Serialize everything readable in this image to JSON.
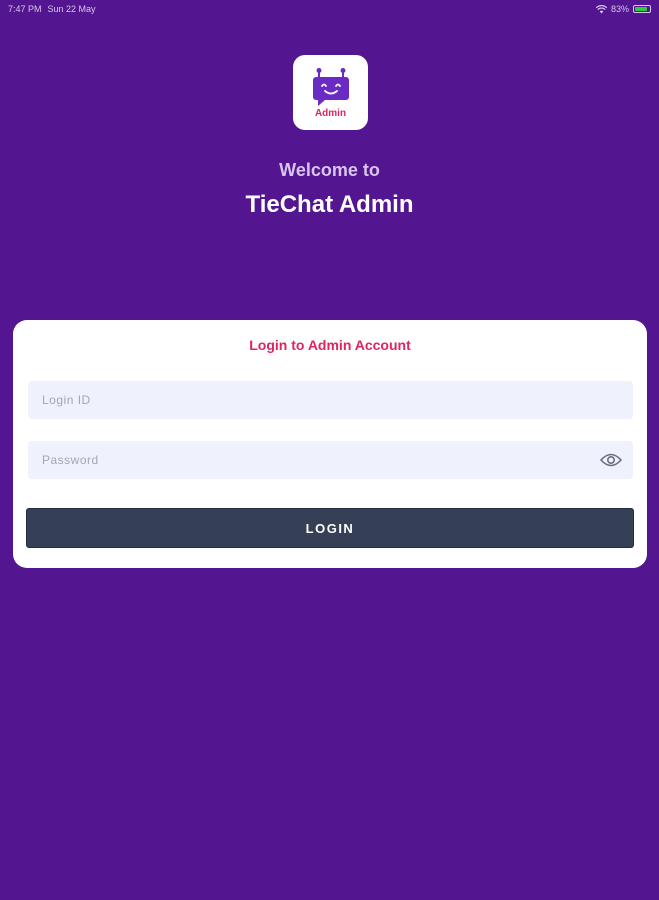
{
  "status_bar": {
    "time": "7:47 PM",
    "date": "Sun 22 May",
    "battery_text": "83%",
    "battery_level": 0.83,
    "wifi_icon": "wifi-icon",
    "battery_icon": "battery-icon"
  },
  "logo": {
    "text": "Admin",
    "icon": "robot-chat-icon",
    "accent_color": "#e0245e",
    "icon_color": "#6a2bc4"
  },
  "header": {
    "welcome": "Welcome to",
    "title": "TieChat Admin"
  },
  "login_card": {
    "title": "Login to Admin Account",
    "login_id_placeholder": "Login ID",
    "login_id_value": "",
    "password_placeholder": "Password",
    "password_value": "",
    "password_toggle_icon": "eye-icon",
    "login_button_label": "LOGIN"
  },
  "colors": {
    "background": "#541690",
    "card": "#ffffff",
    "accent": "#e0245e",
    "button": "#353f55",
    "field": "#eff2fd"
  }
}
